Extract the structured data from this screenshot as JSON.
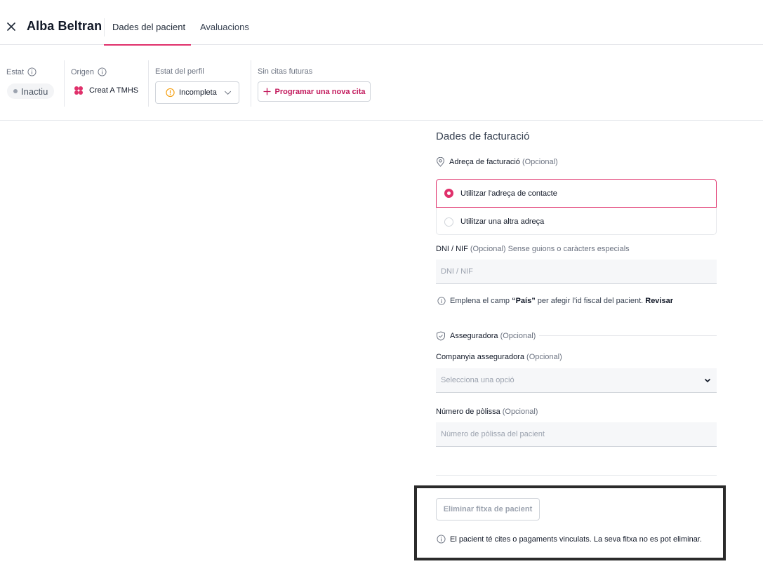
{
  "header": {
    "patient_name": "Alba Beltran",
    "tabs": [
      {
        "label": "Dades del pacient",
        "active": true
      },
      {
        "label": "Avaluacions",
        "active": false
      }
    ]
  },
  "infobar": {
    "estat": {
      "label": "Estat",
      "value": "Inactiu"
    },
    "origen": {
      "label": "Origen",
      "value": "Creat A TMHS"
    },
    "estat_perfil": {
      "label": "Estat del perfil",
      "value": "Incompleta"
    },
    "citas": {
      "label": "Sin citas futuras",
      "button": "Programar una nova cita"
    }
  },
  "billing": {
    "title": "Dades de facturació",
    "address_label": "Adreça de facturació",
    "optional": "(Opcional)",
    "options": [
      {
        "label": "Utilitzar l'adreça de contacte",
        "selected": true
      },
      {
        "label": "Utilitzar una altra adreça",
        "selected": false
      }
    ],
    "dni_label": "DNI / NIF",
    "dni_hint": "Sense guions o caràcters especials",
    "dni_placeholder": "DNI / NIF",
    "helper_prefix": "Emplena el camp",
    "helper_field": "“País”",
    "helper_suffix": "per afegir l’id fiscal del pacient.",
    "helper_link": "Revisar"
  },
  "insurance": {
    "section_label": "Asseguradora",
    "company_label": "Companyia asseguradora",
    "company_placeholder": "Selecciona una opció",
    "policy_label": "Número de pòlissa",
    "policy_placeholder": "Número de pòlissa del pacient"
  },
  "danger": {
    "delete_button": "Eliminar fitxa de pacient",
    "note": "El pacient té cites o pagaments vinculats. La seva fitxa no es pot eliminar."
  },
  "colors": {
    "accent": "#e0306b",
    "warning": "#f59e0b",
    "muted": "#9ca3af"
  }
}
